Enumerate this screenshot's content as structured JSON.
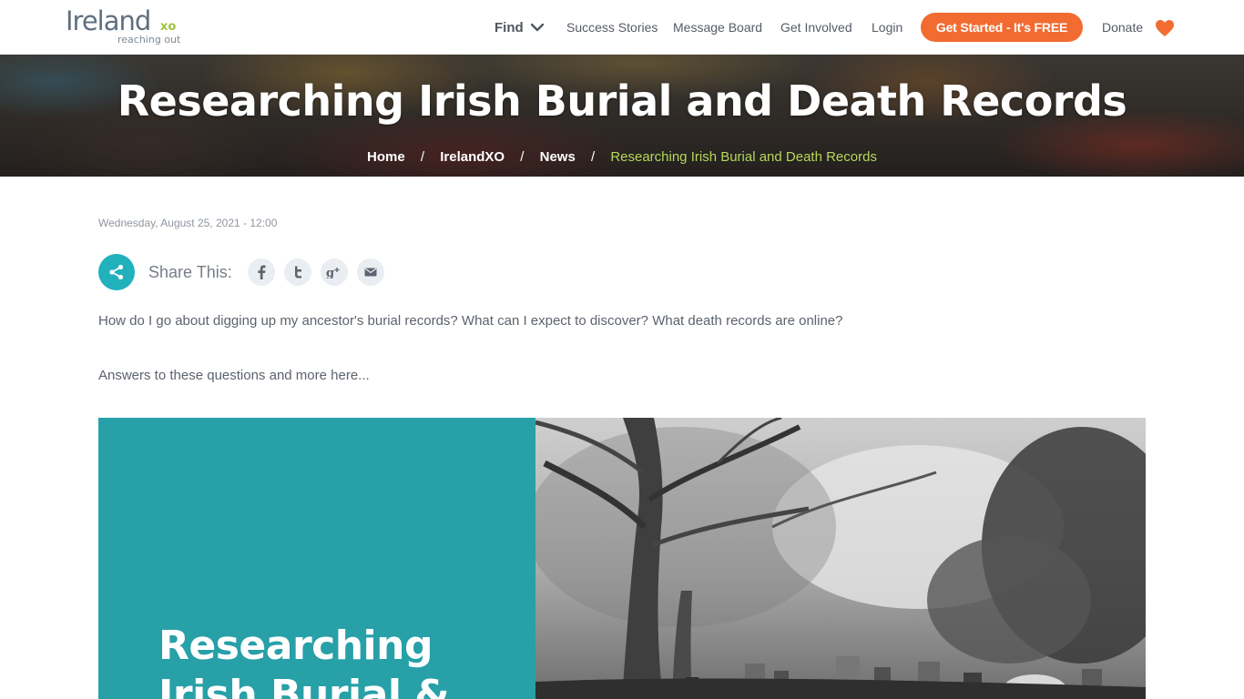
{
  "header": {
    "logo": {
      "main": "Ireland",
      "xo": "xo",
      "sub": "reaching out"
    },
    "nav": {
      "find": "Find",
      "success_stories": "Success Stories",
      "message_board": "Message Board",
      "get_involved": "Get Involved",
      "login": "Login",
      "cta": "Get Started - It's FREE",
      "donate": "Donate"
    }
  },
  "hero": {
    "title": "Researching Irish Burial and Death Records",
    "breadcrumbs": {
      "home": "Home",
      "irelandxo": "IrelandXO",
      "news": "News",
      "current": "Researching Irish Burial and Death Records",
      "separator": "/"
    }
  },
  "article": {
    "date": "Wednesday, August 25, 2021 - 12:00",
    "share_label": "Share This:",
    "share_icons": [
      "facebook-icon",
      "twitter-icon",
      "google-plus-icon",
      "email-icon"
    ],
    "paragraphs": [
      "How do I go about digging up my ancestor's burial records? What can I expect to discover? What death records are online?",
      "Answers to these questions and more here..."
    ],
    "feature_image": {
      "line1": "Researching",
      "line2": "Irish Burial &"
    }
  },
  "colors": {
    "accent_orange": "#f26b31",
    "teal": "#20b1bc",
    "breadcrumb_current": "#b6d85a",
    "logo_green": "#9dc63b"
  }
}
